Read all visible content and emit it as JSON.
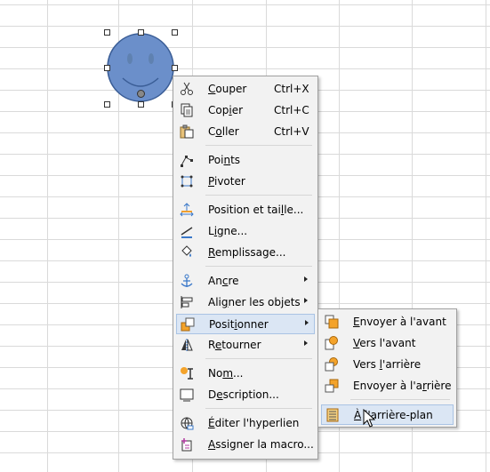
{
  "context_menu": {
    "items": [
      {
        "label_pre": "",
        "label_u": "C",
        "label_post": "ouper",
        "shortcut": "Ctrl+X",
        "icon": "scissors-icon"
      },
      {
        "label_pre": "Cop",
        "label_u": "i",
        "label_post": "er",
        "shortcut": "Ctrl+C",
        "icon": "copy-icon"
      },
      {
        "label_pre": "C",
        "label_u": "o",
        "label_post": "ller",
        "shortcut": "Ctrl+V",
        "icon": "paste-icon"
      },
      {
        "label_pre": "Poi",
        "label_u": "n",
        "label_post": "ts",
        "icon": "points-icon"
      },
      {
        "label_pre": "",
        "label_u": "P",
        "label_post": "ivoter",
        "icon": "rotate-icon"
      },
      {
        "label_pre": "Position et tai",
        "label_u": "l",
        "label_post": "le...",
        "icon": "position-size-icon"
      },
      {
        "label_pre": "L",
        "label_u": "i",
        "label_post": "gne...",
        "icon": "line-icon"
      },
      {
        "label_pre": "",
        "label_u": "R",
        "label_post": "emplissage...",
        "icon": "fill-icon"
      },
      {
        "label_pre": "An",
        "label_u": "c",
        "label_post": "re",
        "icon": "anchor-icon"
      },
      {
        "label_pre": "Ali",
        "label_u": "g",
        "label_post": "ner les objets",
        "icon": "align-icon"
      },
      {
        "label_pre": "Posit",
        "label_u": "i",
        "label_post": "onner",
        "icon": "arrange-icon"
      },
      {
        "label_pre": "R",
        "label_u": "e",
        "label_post": "tourner",
        "icon": "flip-icon"
      },
      {
        "label_pre": "No",
        "label_u": "m",
        "label_post": "...",
        "icon": "name-icon"
      },
      {
        "label_pre": "D",
        "label_u": "e",
        "label_post": "scription...",
        "icon": "description-icon"
      },
      {
        "label_pre": "",
        "label_u": "É",
        "label_post": "diter l'hyperlien",
        "icon": "hyperlink-icon"
      },
      {
        "label_pre": "",
        "label_u": "A",
        "label_post": "ssigner la macro...",
        "icon": "macro-icon"
      }
    ]
  },
  "submenu": {
    "items": [
      {
        "label_pre": "",
        "label_u": "E",
        "label_post": "nvoyer à l'avant",
        "icon": "bring-to-front-icon"
      },
      {
        "label_pre": "",
        "label_u": "V",
        "label_post": "ers l'avant",
        "icon": "bring-forward-icon"
      },
      {
        "label_pre": "Vers ",
        "label_u": "l",
        "label_post": "'arrière",
        "icon": "send-backward-icon"
      },
      {
        "label_pre": "Envoyer à l'a",
        "label_u": "r",
        "label_post": "rière",
        "icon": "send-to-back-icon"
      },
      {
        "label_pre": "",
        "label_u": "À",
        "label_post": " l'arrière-plan",
        "icon": "to-background-icon"
      }
    ]
  },
  "colors": {
    "smiley_fill": "#6b8fca",
    "smiley_stroke": "#3a5d96",
    "highlight": "#dbe6f4"
  }
}
